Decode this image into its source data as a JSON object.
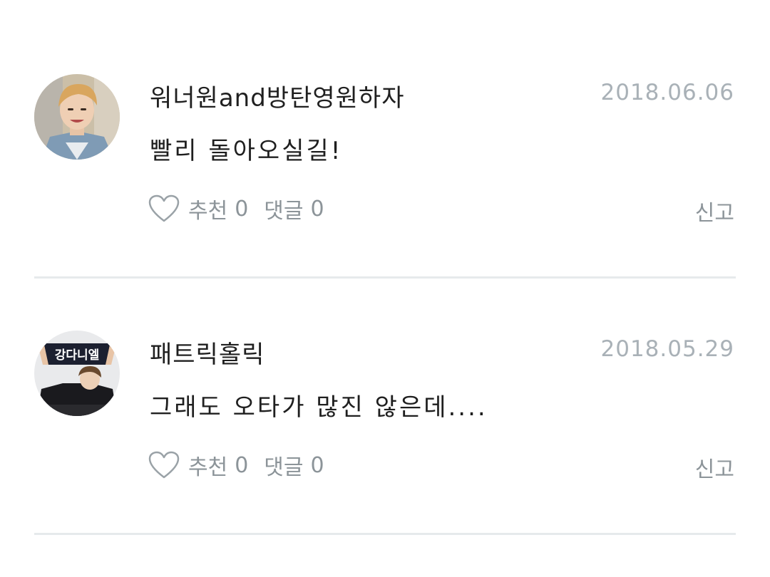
{
  "comments": [
    {
      "username": "워너원and방탄영원하자",
      "date": "2018.06.06",
      "text": "빨리 돌아오실길!",
      "like_label": "추천",
      "like_count": "0",
      "reply_label": "댓글",
      "reply_count": "0",
      "report_label": "신고",
      "avatar_icon": "avatar-photo-person"
    },
    {
      "username": "패트릭홀릭",
      "date": "2018.05.29",
      "text": "그래도 오타가 많진 않은데....",
      "like_label": "추천",
      "like_count": "0",
      "reply_label": "댓글",
      "reply_count": "0",
      "report_label": "신고",
      "avatar_icon": "avatar-photo-banner",
      "avatar_banner_text": "강다니엘"
    }
  ],
  "colors": {
    "text_primary": "#1f1f1f",
    "text_muted": "#8c9499",
    "date": "#a9b1b7",
    "divider": "#e6eaec"
  }
}
